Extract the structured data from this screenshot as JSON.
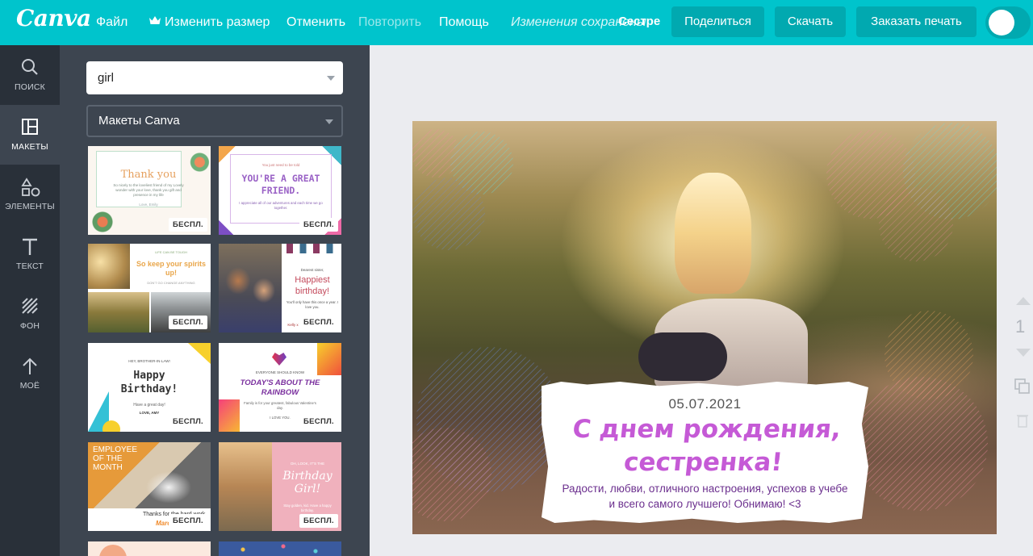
{
  "app": {
    "logo": "Canva",
    "menu": {
      "file": "Файл",
      "resize": "Изменить размер",
      "undo": "Отменить",
      "redo": "Повторить",
      "help": "Помощь"
    },
    "saved_status": "Изменения сохранены",
    "document_name": "Сестре",
    "buttons": {
      "share": "Поделиться",
      "download": "Скачать",
      "print": "Заказать печать"
    }
  },
  "sidebar": {
    "items": [
      {
        "label": "ПОИСК",
        "icon": "search-icon"
      },
      {
        "label": "МАКЕТЫ",
        "icon": "layout-icon",
        "active": true
      },
      {
        "label": "ЭЛЕМЕНТЫ",
        "icon": "shapes-icon"
      },
      {
        "label": "ТЕКСТ",
        "icon": "text-icon"
      },
      {
        "label": "ФОН",
        "icon": "background-icon"
      },
      {
        "label": "МОЁ",
        "icon": "upload-icon"
      }
    ]
  },
  "panel": {
    "search_value": "girl",
    "filter_value": "Макеты Canva",
    "free_badge": "БЕСПЛ.",
    "templates": [
      {
        "title": "Thank you",
        "text": "So nicely to the loveliest friend of my Lovely wonder with your love, thank you gift and presence in my life",
        "sign": "Love, Emily"
      },
      {
        "title": "YOU'RE A GREAT FRIEND.",
        "top": "You just need to be told",
        "text": "I appreciate all of our adventures and each time we go together."
      },
      {
        "title": "So keep your spirits up!",
        "top": "LIFE CAN BE TOUGH",
        "text": "DON'T GO CHANGE ANYTHING"
      },
      {
        "title": "Happiest birthday!",
        "top": "Dearest sister,",
        "text": "You'll only have this once a year. I love you.",
        "sign": "Kelly x"
      },
      {
        "title": "Happy Birthday!",
        "top": "HEY, BROTHER-IN-LAW!",
        "text": "Have a great day!",
        "sign": "LOVE, AMY"
      },
      {
        "title": "TODAY'S ABOUT THE RAINBOW",
        "top": "EVERYONE SHOULD KNOW",
        "text": "Family is for your greatest, fabulous Valentine's day.",
        "sign": "I LOVE YOU."
      },
      {
        "title": "EMPLOYEE OF THE MONTH",
        "text": "Thanks for the hard work",
        "sign": "Marc"
      },
      {
        "title": "Birthday Girl!",
        "top": "OH, LOOK, IT'S THE",
        "text": "Stay golden, kid. Have a happy birthday."
      }
    ]
  },
  "design": {
    "date": "05.07.2021",
    "title_line1": "С днем рождения,",
    "title_line2": "сестренка!",
    "wish": "Радости, любви, отличного настроения, успехов в учебе и всего самого лучшего! Обнимаю! <3",
    "accent_color": "#c55ad6"
  },
  "page_tools": {
    "page_number": "1"
  }
}
